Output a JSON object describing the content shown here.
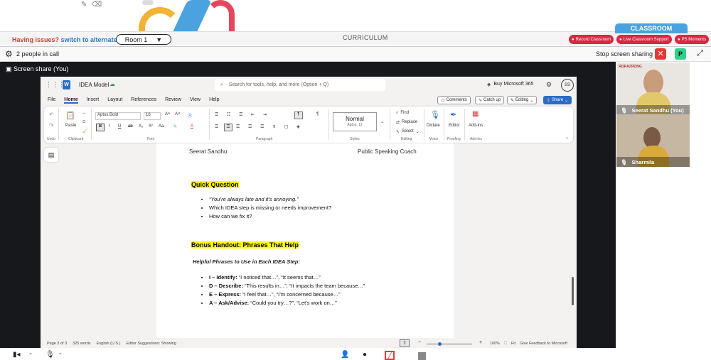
{
  "top": {
    "issues_text": "Having issues?",
    "alternate_link": "switch to alternate room",
    "room": "Room 1",
    "curriculum": "CURRICULUM",
    "classroom_tab": "CLASSROOM",
    "record_btn": "Record Classroom",
    "support_btn": "Live Classroom Support",
    "moments_btn": "PS Moments"
  },
  "call": {
    "people": "2 people in call",
    "stop_share": "Stop screen sharing",
    "p_button": "P",
    "share_label": "Screen share (You)"
  },
  "word": {
    "doc_name": "IDEA Model",
    "search_placeholder": "Search for tools, help, and more (Option + Q)",
    "buy": "Buy Microsoft 365",
    "avatar": "SS",
    "menus": [
      "File",
      "Home",
      "Insert",
      "Layout",
      "References",
      "Review",
      "View",
      "Help"
    ],
    "comments": "Comments",
    "catch_up": "Catch up",
    "editing": "Editing",
    "share": "Share",
    "undo_label": "Undo",
    "clipboard_label": "Clipboard",
    "paste": "Paste",
    "font_name": "Aptos Bold",
    "font_size": "16",
    "font_label": "Font",
    "paragraph_label": "Paragraph",
    "style_normal": "Normal",
    "style_sub": "Aptos, 12",
    "styles_label": "Styles",
    "find": "Find",
    "replace": "Replace",
    "select": "Select",
    "editing_label": "Editing",
    "dictate": "Dictate",
    "voice_label": "Voice",
    "editor": "Editor",
    "proofing_label": "Proofing",
    "addins": "Add-ins",
    "addins_label": "Add-ins"
  },
  "doc": {
    "header_left": "Seerat Sandhu",
    "header_right": "Public Speaking Coach",
    "quick_question": "Quick Question",
    "qq_items": [
      "“You’re always late and it’s annoying.”",
      "Which IDEA step is missing or needs improvement?",
      "How can we fix it?"
    ],
    "bonus": "Bonus Handout: Phrases That Help",
    "helpful": "Helpful Phrases to Use in Each IDEA Step:",
    "steps": [
      {
        "k": "I – Identify:",
        "v": " “I noticed that…”, “It seems that…”"
      },
      {
        "k": "D – Describe:",
        "v": " “This results in…”, “It impacts the team because…”"
      },
      {
        "k": "E – Express:",
        "v": " “I feel that…”, “I’m concerned because…”"
      },
      {
        "k": "A – Ask/Advise:",
        "v": " “Could you try…?”, “Let’s work on…”"
      }
    ]
  },
  "status": {
    "page": "Page 3 of 3",
    "words": "325 words",
    "lang": "English (U.S.)",
    "suggestions": "Editor Suggestions: Showing",
    "zoom": "100%",
    "fit": "Fit",
    "feedback": "Give Feedback to Microsoft"
  },
  "participants": [
    {
      "name": "Seerat Sandhu (You)"
    },
    {
      "name": "Sharmila"
    }
  ],
  "colors": {
    "accent": "#4aa3df",
    "record": "#d62a44",
    "highlight": "#ffff00",
    "word_blue": "#2b6cc4"
  }
}
